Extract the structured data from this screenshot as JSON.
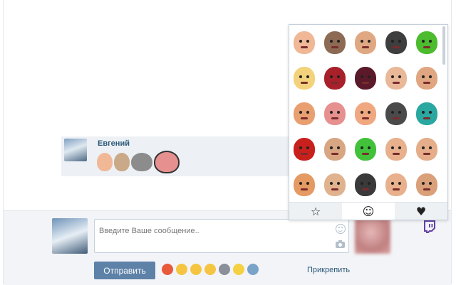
{
  "message": {
    "author": "Евгений",
    "stickers": [
      "face-sticker",
      "face-sticker",
      "cat-sticker",
      "isaac-sticker"
    ]
  },
  "composer": {
    "placeholder": "Введите Ваше сообщение..",
    "send_label": "Отправить",
    "attach_label": "Прикрепить",
    "quick_emojis": [
      {
        "icon": "heart-icon",
        "bg": "#e85a3c"
      },
      {
        "icon": "laughing-icon",
        "bg": "#f5c542"
      },
      {
        "icon": "tired-icon",
        "bg": "#f5c542"
      },
      {
        "icon": "grimace-icon",
        "bg": "#f5c542"
      },
      {
        "icon": "gray-face-icon",
        "bg": "#8a8f99"
      },
      {
        "icon": "smile-icon",
        "bg": "#f5d142"
      },
      {
        "icon": "vk-building-icon",
        "bg": "#7aa3c9"
      }
    ]
  },
  "sticker_popup": {
    "tabs": [
      {
        "icon": "star-icon",
        "glyph": "☆",
        "active": false
      },
      {
        "icon": "smiley-icon",
        "glyph": "☺",
        "active": true
      },
      {
        "icon": "heart-icon",
        "glyph": "♥",
        "active": false
      }
    ],
    "stickers": [
      {
        "name": "bald-guy-sticker",
        "color": "#f0b896"
      },
      {
        "name": "white-cap-guy-sticker",
        "color": "#8c6a54"
      },
      {
        "name": "cap-guy-sticker",
        "color": "#e0a882"
      },
      {
        "name": "dark-hair-girl-sticker",
        "color": "#3e3e3e"
      },
      {
        "name": "twitch-logo-sticker",
        "color": "#4cbb2e"
      },
      {
        "name": "blonde-girl-sticker",
        "color": "#f2d27a"
      },
      {
        "name": "red-devil-sticker",
        "color": "#a8202a"
      },
      {
        "name": "dark-devil-sticker",
        "color": "#5a1a2a"
      },
      {
        "name": "baby-sticker",
        "color": "#e9b899"
      },
      {
        "name": "sunglasses-guy-sticker",
        "color": "#e0a682"
      },
      {
        "name": "bearded-guy-sticker",
        "color": "#e8a070"
      },
      {
        "name": "isaac-sticker",
        "color": "#e69090"
      },
      {
        "name": "bald-grin-sticker",
        "color": "#f0a880"
      },
      {
        "name": "cat-sticker",
        "color": "#4a4a4a"
      },
      {
        "name": "teal-hair-sticker",
        "color": "#2aa7a0"
      },
      {
        "name": "meat-boy-sticker",
        "color": "#c8201c"
      },
      {
        "name": "dark-hair-guy-sticker",
        "color": "#d8a682"
      },
      {
        "name": "green-alien-sticker",
        "color": "#42c23a"
      },
      {
        "name": "surprised-guy-sticker",
        "color": "#e8b08c"
      },
      {
        "name": "glasses-guy-sticker",
        "color": "#e5ad8a"
      },
      {
        "name": "ginger-guy-sticker",
        "color": "#e49a62"
      },
      {
        "name": "asian-guy-sticker",
        "color": "#e0b28e"
      },
      {
        "name": "beanie-guy-sticker",
        "color": "#3a3a3a"
      },
      {
        "name": "blue-shades-sticker",
        "color": "#e8b08c"
      },
      {
        "name": "smiling-guy-sticker",
        "color": "#d9a07a"
      }
    ]
  }
}
